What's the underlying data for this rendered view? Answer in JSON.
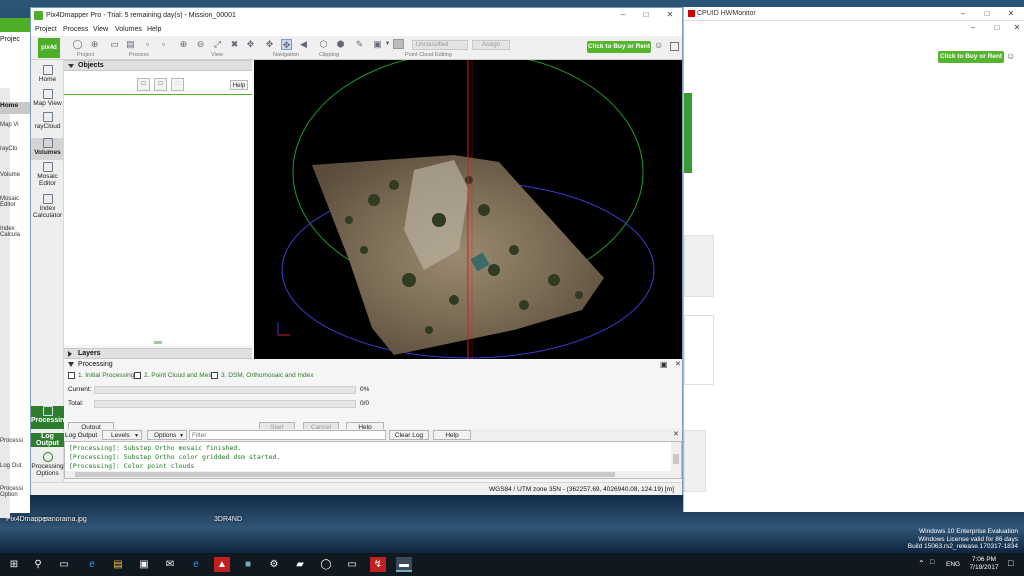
{
  "desktop": {
    "icons": [
      "Pix4Dmapper",
      "panorama.jpg",
      "3DR4ND"
    ],
    "watermark": {
      "line1": "Windows 10 Enterprise Evaluation",
      "line2": "Windows License valid for 86 days",
      "line3": "Build 15063.rs2_release.170317-1834"
    }
  },
  "bg_window": {
    "title": "CPUID HWMonitor",
    "buy_label": "Click to Buy or Rent"
  },
  "left_app": {
    "labels": [
      "Projec",
      "Home",
      "Map Vi",
      "rayClo",
      "Volume",
      "Mosaic Editor",
      "Index Calcula",
      "Processi",
      "Log Out",
      "Processi Option"
    ]
  },
  "app": {
    "title": "Pix4Dmapper Pro - Trial: 5 remaining day(s) - Mission_00001",
    "logo": "pix4d",
    "menu": [
      "Project",
      "Process",
      "View",
      "Volumes",
      "Help"
    ],
    "toolbar": {
      "groups": [
        "Project",
        "Process",
        "View",
        "Navigation",
        "Clipping",
        "Point Cloud Editing"
      ],
      "class_dropdown": "Unclassified",
      "assign_label": "Assign",
      "buy_label": "Click to Buy or Rent"
    },
    "nav": [
      {
        "label": "Home",
        "icon": "home-icon"
      },
      {
        "label": "Map View",
        "icon": "map-icon"
      },
      {
        "label": "rayCloud",
        "icon": "raycloud-icon"
      },
      {
        "label": "Volumes",
        "icon": "volumes-icon"
      },
      {
        "label": "Mosaic Editor",
        "icon": "mosaic-icon"
      },
      {
        "label": "Index Calculator",
        "icon": "calculator-icon"
      },
      {
        "label": "Processing",
        "icon": "processing-icon"
      },
      {
        "label": "Log Output",
        "icon": "log-icon"
      },
      {
        "label": "Processing Options",
        "icon": "gear-icon"
      }
    ],
    "objects": {
      "header": "Objects",
      "help": "Help"
    },
    "layers": {
      "header": "Layers"
    },
    "processing": {
      "header": "Processing",
      "steps": [
        "1. Initial Processing",
        "2. Point Cloud and Mesh",
        "3. DSM, Orthomosaic and Index"
      ],
      "current_label": "Current:",
      "current_value": "0%",
      "total_label": "Total:",
      "total_value": "0/0",
      "output_status": "Output Status...",
      "start": "Start",
      "cancel": "Cancel",
      "help": "Help"
    },
    "log": {
      "title": "Log Output",
      "levels": "Levels",
      "options": "Options",
      "filter_placeholder": "Filter",
      "clear": "Clear Log",
      "help": "Help",
      "lines": [
        "[Processing]: Substep Ortho mosaic finished.",
        "[Processing]: Substep Ortho color gridded dsm started.",
        "[Processing]: Color point clouds"
      ]
    },
    "status": "WGS84 / UTM zone 35N - (362257.69, 4026940.08, 124.19) [m]"
  },
  "taskbar": {
    "time": "7:06 PM",
    "date": "7/18/2017",
    "lang": "ENG"
  }
}
